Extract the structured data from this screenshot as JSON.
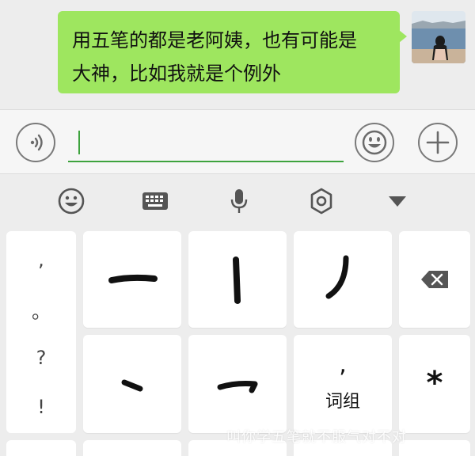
{
  "chat": {
    "message_line1": "用五笔的都是老阿姨，也有可能是",
    "message_line2": "大神，比如我就是个例外"
  },
  "input": {
    "value": "",
    "icons": {
      "voice": "voice-icon",
      "emoji": "emoji-icon",
      "more": "plus-icon"
    }
  },
  "keyboard": {
    "toolbar_icons": [
      "emoji-icon",
      "keyboard-icon",
      "microphone-icon",
      "settings-icon",
      "collapse-triangle-icon"
    ],
    "punctuation": [
      ",",
      "。",
      "?",
      "!"
    ],
    "stroke_keys": [
      "横",
      "竖",
      "撇",
      "点",
      "折"
    ],
    "comma_key": {
      "symbol": ",",
      "label": "词组"
    },
    "star_key": "*",
    "delete_icon": "backspace-icon"
  },
  "watermark": "叫你学五笔就不服气对不对"
}
